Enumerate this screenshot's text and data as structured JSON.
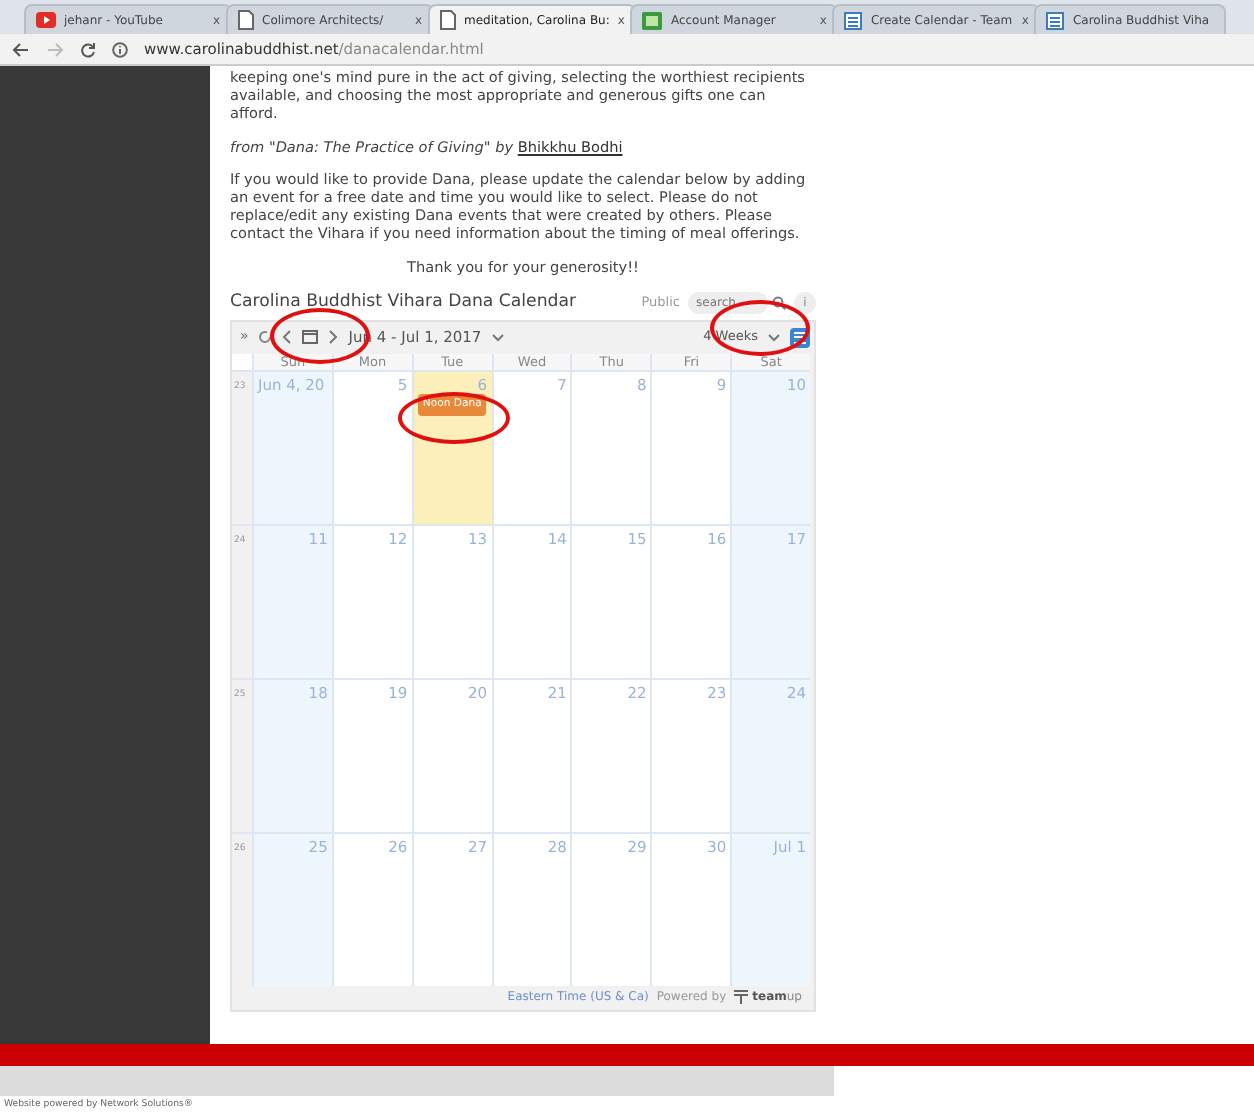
{
  "tabs": [
    {
      "title": "jehanr - YouTube",
      "kind": "video",
      "close": "x",
      "selected": false
    },
    {
      "title": "Colimore Architects/",
      "kind": "page",
      "close": "x",
      "selected": false
    },
    {
      "title": "meditation, Carolina Bu:",
      "kind": "page",
      "close": "x",
      "selected": true
    },
    {
      "title": "Account Manager",
      "kind": "account",
      "close": "x",
      "selected": false
    },
    {
      "title": "Create Calendar - Team",
      "kind": "calendar",
      "close": "x",
      "selected": false
    },
    {
      "title": "Carolina Buddhist Viha",
      "kind": "calendar",
      "selected": false
    }
  ],
  "address": {
    "host": "www.carolinabuddhist.net",
    "path": "/danacalendar.html"
  },
  "article": {
    "paragraph_1": "keeping one's mind pure in the act of giving, selecting the worthiest recipients available, and choosing the most appropriate and generous gifts one can afford.",
    "citation": "*from \"Dana: The Practice of Giving\" by*",
    "citation_author": "Bhikkhu Bodhi",
    "paragraph_2": "If you would like to provide Dana, please update the calendar below by adding an event for a free date and time you would like to select. Please do not replace/edit any existing Dana events that were created by others. Please contact the Vihara if you need information about the timing of meal offerings.",
    "thanks": "Thank you for your generosity!!"
  },
  "calendar": {
    "title": "Carolina Buddhist Vihara Dana Calendar",
    "access": "Public",
    "search": {
      "placeholder": "search"
    },
    "info": "i",
    "expand": "»",
    "navigation_circled": true,
    "date_range": "Jun 4 - Jul 1, 2017",
    "view": "4 Weeks",
    "view_circled": true,
    "weekdays": [
      "Sun",
      "Mon",
      "Tue",
      "Wed",
      "Thu",
      "Fri",
      "Sat"
    ],
    "weeks": [
      {
        "number": "23",
        "days": [
          {
            "label": "Jun 4, 20",
            "weekend": true,
            "today": false
          },
          {
            "label": "5",
            "weekend": false,
            "today": false
          },
          {
            "label": "6",
            "weekend": false,
            "today": true,
            "events": [
              {
                "title": "Noon Dana",
                "color": "#e8893a",
                "circled": true
              }
            ]
          },
          {
            "label": "7",
            "weekend": false,
            "today": false
          },
          {
            "label": "8",
            "weekend": false,
            "today": false
          },
          {
            "label": "9",
            "weekend": false,
            "today": false
          },
          {
            "label": "10",
            "weekend": true,
            "today": false
          }
        ]
      },
      {
        "number": "24",
        "days": [
          {
            "label": "11",
            "weekend": true,
            "today": false
          },
          {
            "label": "12",
            "weekend": false,
            "today": false
          },
          {
            "label": "13",
            "weekend": false,
            "today": false
          },
          {
            "label": "14",
            "weekend": false,
            "today": false
          },
          {
            "label": "15",
            "weekend": false,
            "today": false
          },
          {
            "label": "16",
            "weekend": false,
            "today": false
          },
          {
            "label": "17",
            "weekend": true,
            "today": false
          }
        ]
      },
      {
        "number": "25",
        "days": [
          {
            "label": "18",
            "weekend": true,
            "today": false
          },
          {
            "label": "19",
            "weekend": false,
            "today": false
          },
          {
            "label": "20",
            "weekend": false,
            "today": false
          },
          {
            "label": "21",
            "weekend": false,
            "today": false
          },
          {
            "label": "22",
            "weekend": false,
            "today": false
          },
          {
            "label": "23",
            "weekend": false,
            "today": false
          },
          {
            "label": "24",
            "weekend": true,
            "today": false
          }
        ]
      },
      {
        "number": "26",
        "days": [
          {
            "label": "25",
            "weekend": true,
            "today": false
          },
          {
            "label": "26",
            "weekend": false,
            "today": false
          },
          {
            "label": "27",
            "weekend": false,
            "today": false
          },
          {
            "label": "28",
            "weekend": false,
            "today": false
          },
          {
            "label": "29",
            "weekend": false,
            "today": false
          },
          {
            "label": "30",
            "weekend": false,
            "today": false
          },
          {
            "label": "Jul 1",
            "weekend": true,
            "today": false
          }
        ]
      }
    ],
    "timezone": "Eastern Time (US & Ca)",
    "powered_by": "Powered by",
    "brand": "**team**up"
  },
  "site_footer": "Website powered by Network Solutions®"
}
